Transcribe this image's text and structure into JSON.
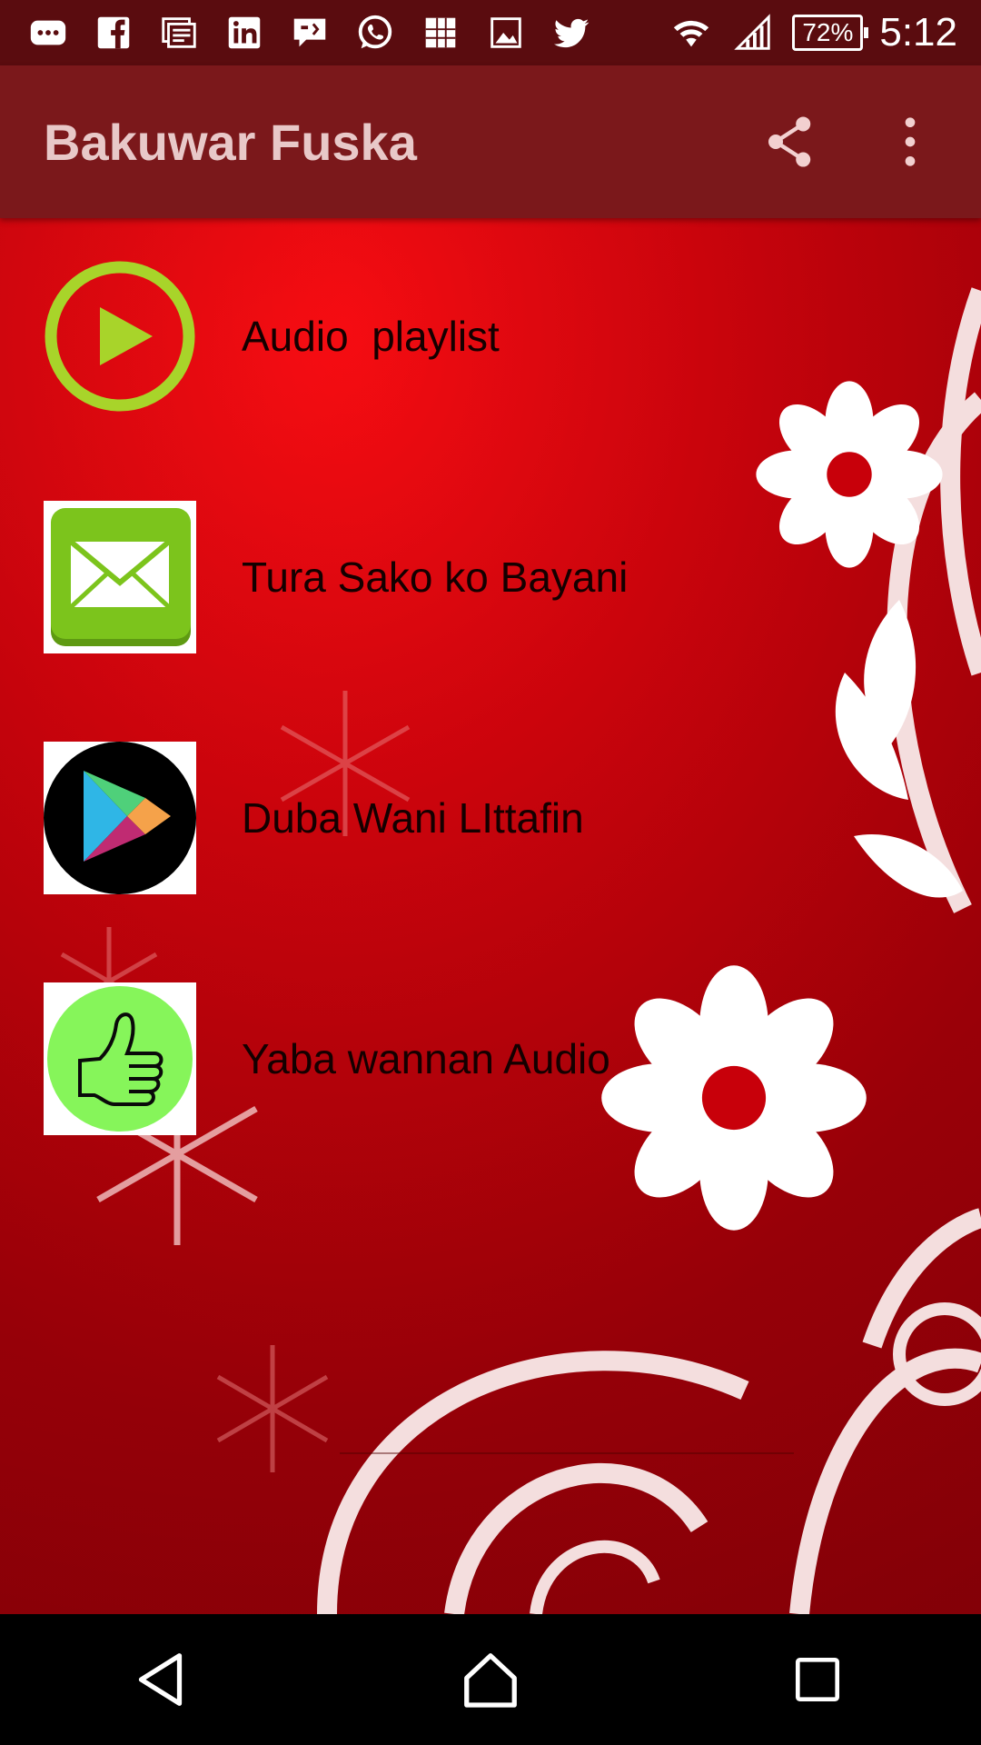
{
  "status_bar": {
    "battery": "72%",
    "time": "5:12",
    "notification_icons": [
      "messages-icon",
      "facebook-icon",
      "news-icon",
      "linkedin-icon",
      "chat-icon",
      "whatsapp-icon",
      "puzzle-icon",
      "image-icon",
      "twitter-icon"
    ]
  },
  "toolbar": {
    "title": "Bakuwar Fuska",
    "actions": [
      "share-icon",
      "more-options-icon"
    ]
  },
  "menu": {
    "items": [
      {
        "label": "Audio  playlist",
        "icon": "play-circle-icon"
      },
      {
        "label": "Tura Sako ko Bayani",
        "icon": "mail-icon"
      },
      {
        "label": "Duba Wani LIttafin",
        "icon": "play-store-icon"
      },
      {
        "label": "Yaba wannan Audio",
        "icon": "thumbs-up-icon"
      }
    ]
  },
  "nav_bar": [
    "back-icon",
    "home-icon",
    "recents-icon"
  ],
  "colors": {
    "status_bar": "#5a0c0f",
    "toolbar": "#7b181b",
    "background_red": "#d4000d",
    "play_ring": "#a8d42a",
    "mail_green": "#7cc41c",
    "thumb_green": "#86f55a"
  }
}
